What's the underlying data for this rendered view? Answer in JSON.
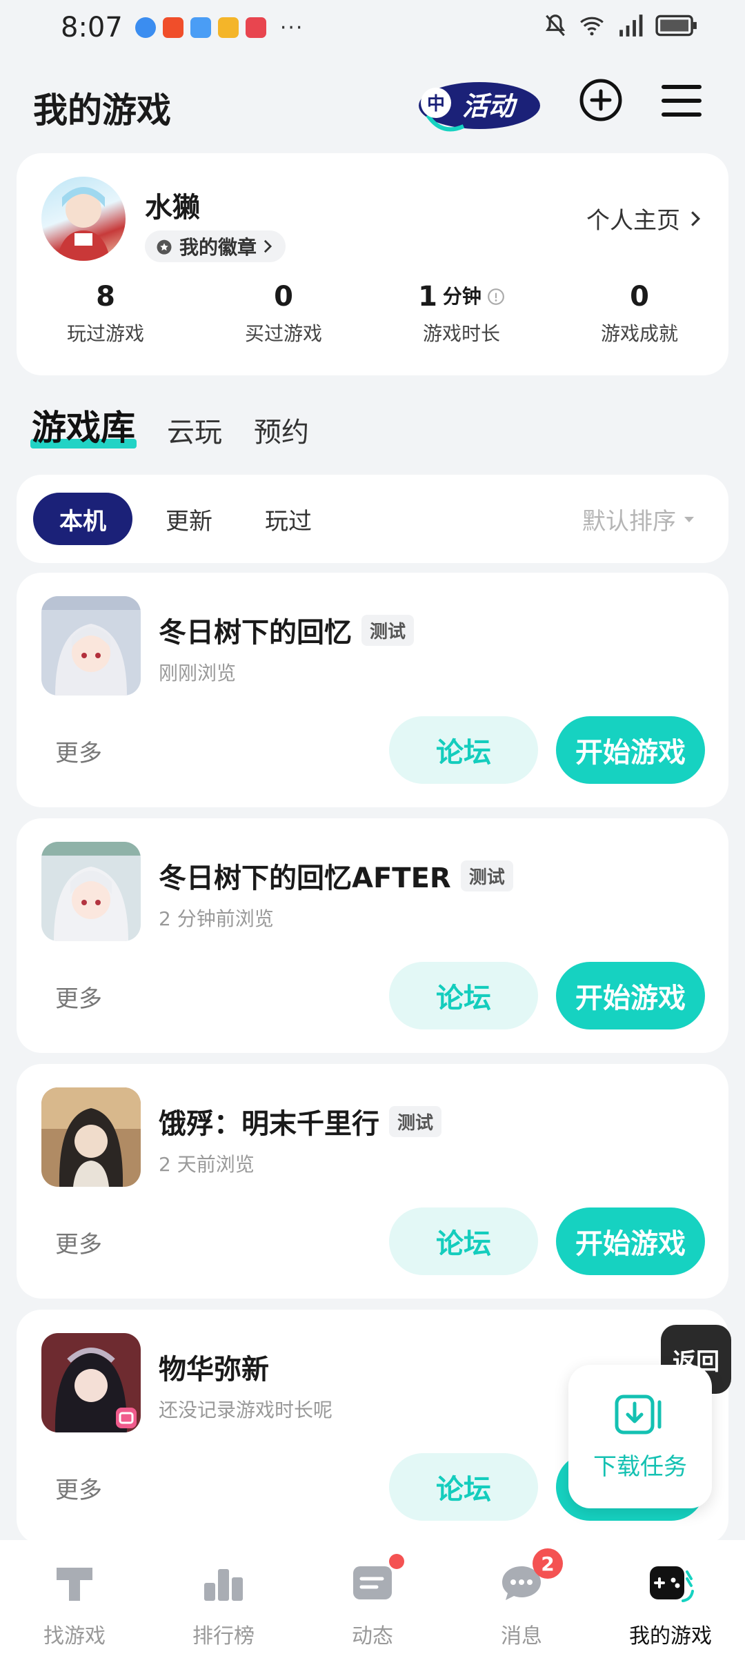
{
  "status_bar": {
    "time": "8:07",
    "more": "···"
  },
  "header": {
    "title": "我的游戏",
    "activity_label": "活动"
  },
  "profile": {
    "name": "水獭",
    "badge_label": "我的徽章",
    "homepage_label": "个人主页",
    "stats": [
      {
        "value": "8",
        "unit": "",
        "label": "玩过游戏"
      },
      {
        "value": "0",
        "unit": "",
        "label": "买过游戏"
      },
      {
        "value": "1",
        "unit": "分钟",
        "label": "游戏时长"
      },
      {
        "value": "0",
        "unit": "",
        "label": "游戏成就"
      }
    ]
  },
  "library_tabs": [
    "游戏库",
    "云玩",
    "预约"
  ],
  "filters": {
    "chips": [
      "本机",
      "更新",
      "玩过"
    ],
    "sort_label": "默认排序"
  },
  "games": [
    {
      "name": "冬日树下的回忆",
      "tag": "测试",
      "sub": "刚刚浏览",
      "more": "更多",
      "forum": "论坛",
      "play": "开始游戏"
    },
    {
      "name": "冬日树下的回忆AFTER",
      "tag": "测试",
      "sub": "2 分钟前浏览",
      "more": "更多",
      "forum": "论坛",
      "play": "开始游戏"
    },
    {
      "name": "饿殍：明末千里行",
      "tag": "测试",
      "sub": "2 天前浏览",
      "more": "更多",
      "forum": "论坛",
      "play": "开始游戏"
    },
    {
      "name": "物华弥新",
      "tag": "",
      "sub": "还没记录游戏时长呢",
      "more": "更多",
      "forum": "论坛",
      "play": "开始游戏"
    }
  ],
  "floating": {
    "return_label": "返回",
    "download_label": "下载任务"
  },
  "bottom_nav": [
    {
      "label": "找游戏",
      "icon": "find-game-icon"
    },
    {
      "label": "排行榜",
      "icon": "leaderboard-icon"
    },
    {
      "label": "动态",
      "icon": "feed-icon"
    },
    {
      "label": "消息",
      "icon": "message-icon",
      "badge": "2"
    },
    {
      "label": "我的游戏",
      "icon": "gamepad-icon"
    }
  ],
  "colors": {
    "accent": "#16d2c1",
    "active_chip": "#1b2178",
    "badge_red": "#f45252",
    "background": "#f2f4f6"
  }
}
